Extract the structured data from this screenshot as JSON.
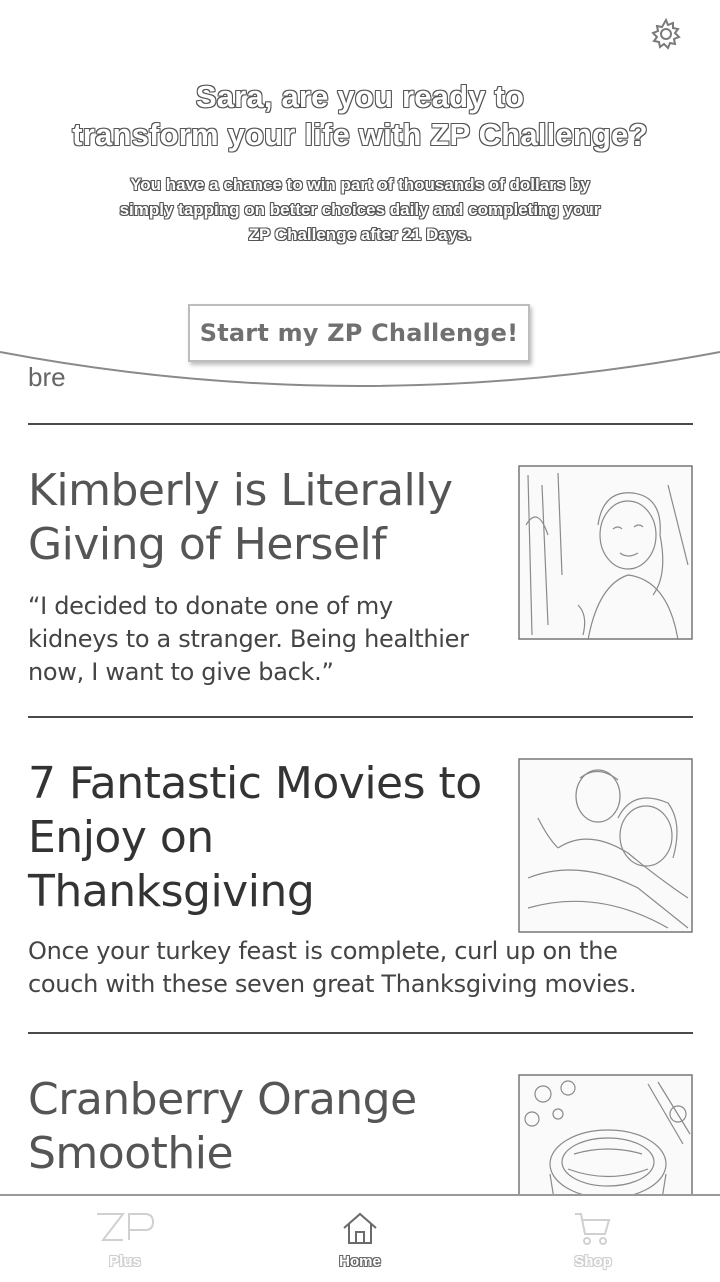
{
  "hero": {
    "title_line1": "Sara, are you ready to",
    "title_line2": "transform your life with ZP Challenge?",
    "subtitle_line1": "You have a chance to win part of thousands of dollars by",
    "subtitle_line2": "simply tapping on better choices daily and completing your",
    "subtitle_line3": "ZP Challenge after 21 Days.",
    "cta_label": "Start my ZP Challenge!",
    "settings_icon": "gear-icon"
  },
  "feed": {
    "peek_text": "bre",
    "articles": [
      {
        "title_line1": "Kimberly is Literally",
        "title_line2": "Giving of Herself",
        "excerpt_line1": "“I decided to donate one of my",
        "excerpt_line2": "kidneys to a stranger. Being healthier",
        "excerpt_line3": "now, I want to give back.”",
        "thumbnail": "woman-portrait-photo"
      },
      {
        "title_line1": "7 Fantastic Movies to",
        "title_line2": "Enjoy on",
        "title_line3": "Thanksgiving",
        "excerpt_line1": "Once your turkey feast is complete, curl up on the",
        "excerpt_line2": "couch with these seven great Thanksgiving movies.",
        "thumbnail": "couple-on-couch-photo"
      },
      {
        "title_line1": "Cranberry Orange",
        "title_line2": "Smoothie",
        "thumbnail": "smoothie-bowl-photo"
      }
    ]
  },
  "nav": {
    "items": [
      {
        "label": "Plus",
        "icon": "zp-logo-icon",
        "active": false
      },
      {
        "label": "Home",
        "icon": "home-icon",
        "active": true
      },
      {
        "label": "Shop",
        "icon": "cart-icon",
        "active": false
      }
    ]
  }
}
